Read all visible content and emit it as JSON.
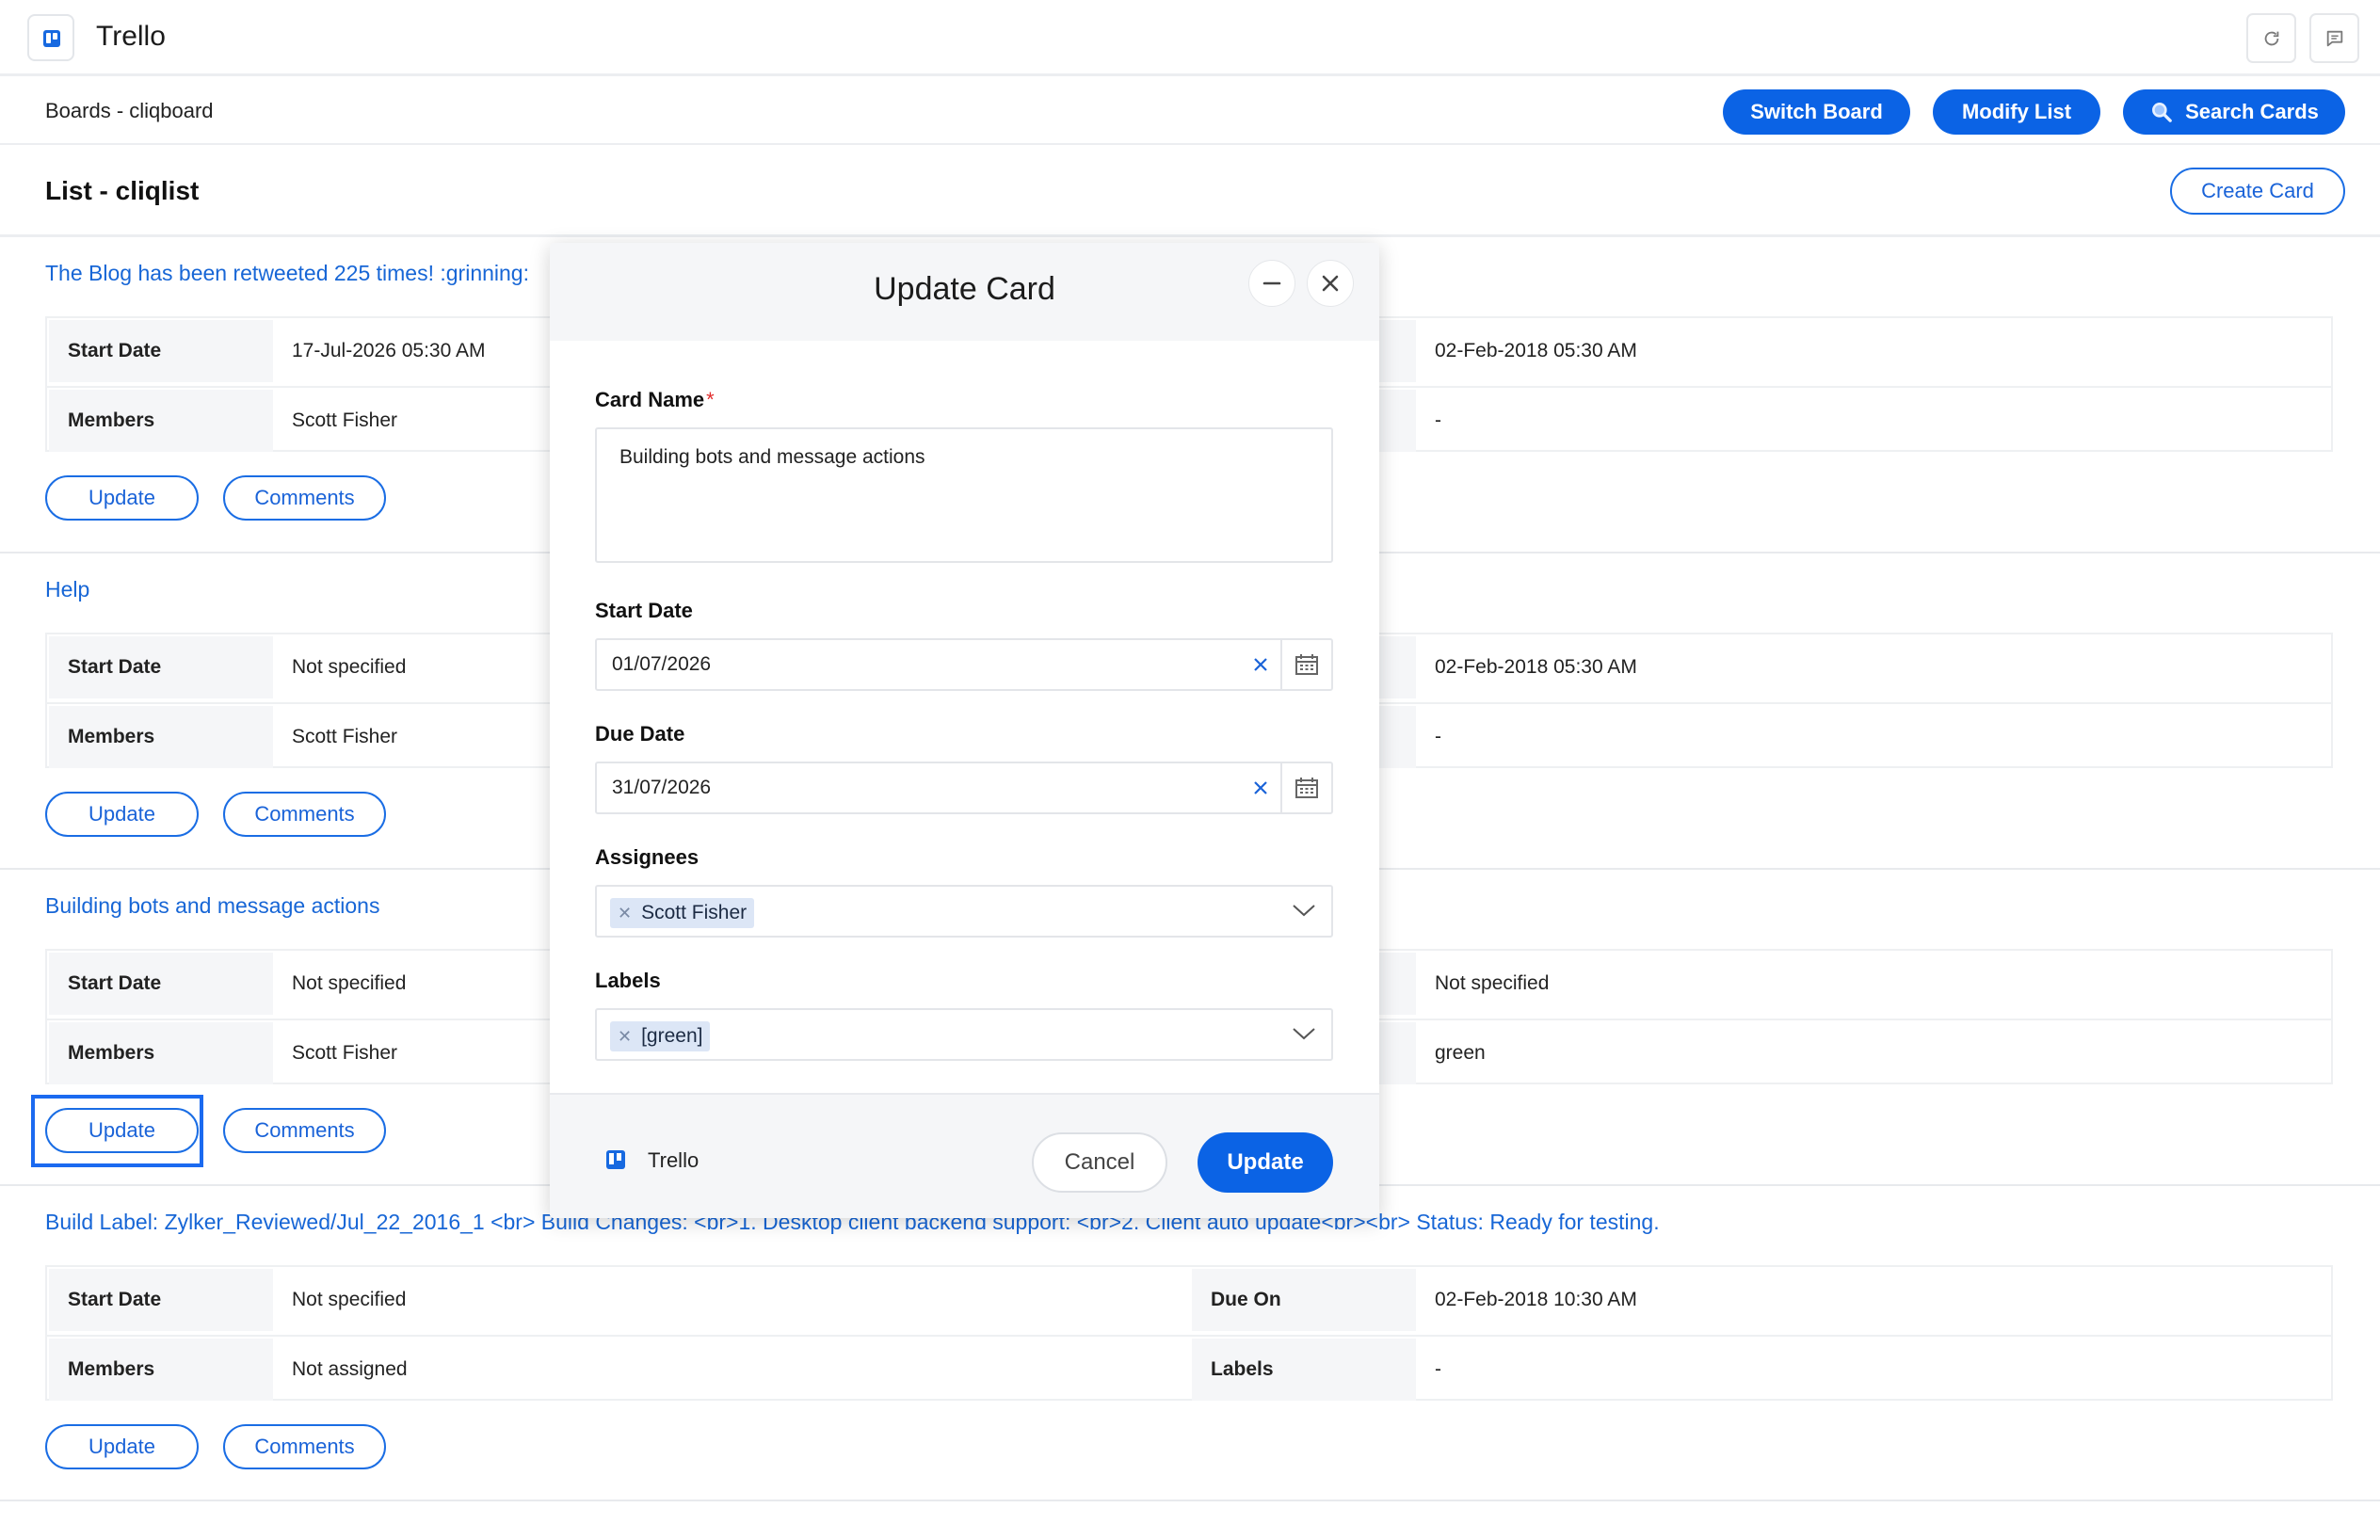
{
  "app": {
    "title": "Trello"
  },
  "subbar": {
    "breadcrumb": "Boards - cliqboard",
    "buttons": {
      "switch": "Switch Board",
      "modify": "Modify List",
      "search": "Search Cards"
    }
  },
  "list": {
    "title": "List - cliqlist",
    "create_button": "Create Card"
  },
  "labels": {
    "start_date": "Start Date",
    "members": "Members",
    "due_on": "Due On",
    "labels": "Labels",
    "update": "Update",
    "comments": "Comments"
  },
  "cards": [
    {
      "title": "The Blog has been retweeted 225 times!  :grinning:",
      "start": "17-Jul-2026 05:30 AM",
      "members": "Scott Fisher",
      "due": "02-Feb-2018 05:30 AM",
      "labels": "-"
    },
    {
      "title": "Help",
      "start": "Not specified",
      "members": "Scott Fisher",
      "due": "02-Feb-2018 05:30 AM",
      "labels": "-"
    },
    {
      "title": "Building bots and message actions",
      "start": "Not specified",
      "members": "Scott Fisher",
      "due": "Not specified",
      "labels": "green"
    },
    {
      "title": "Build Label: Zylker_Reviewed/Jul_22_2016_1 <br> Build Changes: <br>1. Desktop client backend support: <br>2. Client auto update<br><br> Status: Ready for testing.",
      "start": "Not specified",
      "members": "Not assigned",
      "due": "02-Feb-2018 10:30 AM",
      "labels": "-"
    }
  ],
  "modal": {
    "title": "Update Card",
    "card_name_label": "Card Name",
    "required_mark": "*",
    "card_name_value": "Building bots and message actions",
    "start_date_label": "Start Date",
    "start_date_value": "01/07/2026",
    "due_date_label": "Due Date",
    "due_date_value": "31/07/2026",
    "assignees_label": "Assignees",
    "assignee_chip": "Scott Fisher",
    "labels_label": "Labels",
    "label_chip": "[green]",
    "footer_app": "Trello",
    "cancel": "Cancel",
    "update": "Update"
  },
  "icons": [
    "trello-logo-icon",
    "refresh-icon",
    "chat-icon",
    "search-icon",
    "minimize-icon",
    "close-icon",
    "clear-icon",
    "calendar-icon",
    "chevron-down-icon"
  ],
  "colors": {
    "accent": "#0b63e5",
    "link": "#1766d6",
    "required": "#e12d2d"
  }
}
